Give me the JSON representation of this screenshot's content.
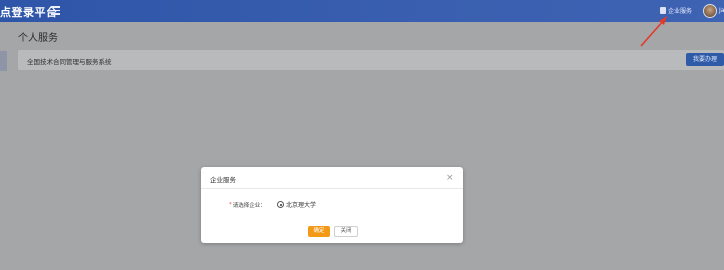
{
  "header": {
    "title": "点登录平台",
    "enterprise_service": "企业服务",
    "user_text": "Ja"
  },
  "page": {
    "title": "个人服务",
    "system_name": "全国技术合同管理与服务系统",
    "go_button": "我要办理"
  },
  "dialog": {
    "title": "企业服务",
    "close_symbol": "×",
    "field_required_mark": "*",
    "field_label": "请选择企业：",
    "options": [
      {
        "label": "北京理大学",
        "selected": true
      }
    ],
    "confirm_label": "确定",
    "cancel_label": "关闭"
  },
  "colors": {
    "topbar": "#3a5fb0",
    "overlay_bg": "#a5a6a8",
    "confirm": "#f29a17",
    "go_button": "#2e5aa8",
    "annotation_arrow": "#e23a2a"
  }
}
